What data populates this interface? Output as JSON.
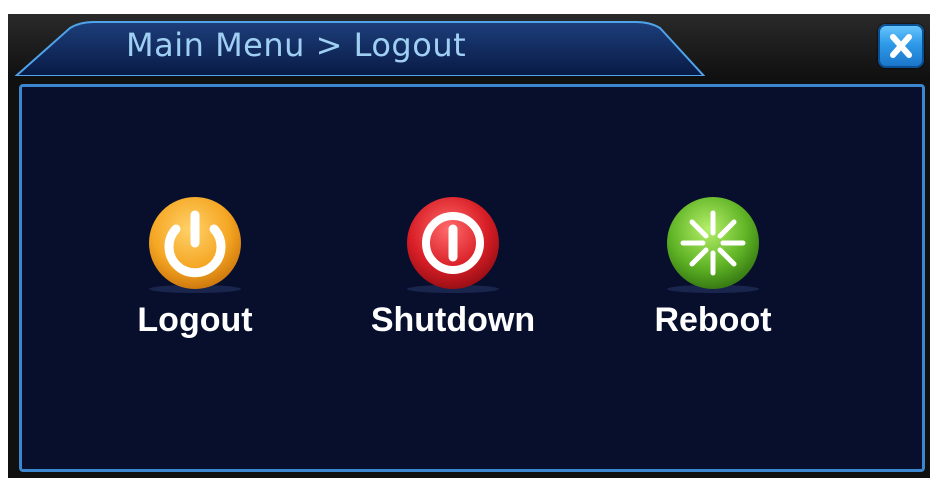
{
  "window": {
    "title": "Main Menu > Logout",
    "close_icon": "close-icon"
  },
  "actions": [
    {
      "id": "logout",
      "label": "Logout",
      "icon": "power-icon",
      "color": "#f5a623"
    },
    {
      "id": "shutdown",
      "label": "Shutdown",
      "icon": "shutdown-icon",
      "color": "#d81e26"
    },
    {
      "id": "reboot",
      "label": "Reboot",
      "icon": "reboot-icon",
      "color": "#5fb325"
    }
  ],
  "colors": {
    "title_text": "#9fcff2",
    "panel_bg": "#070f2d",
    "panel_border": "#3b86cf",
    "accent": "#2e9ae8"
  }
}
